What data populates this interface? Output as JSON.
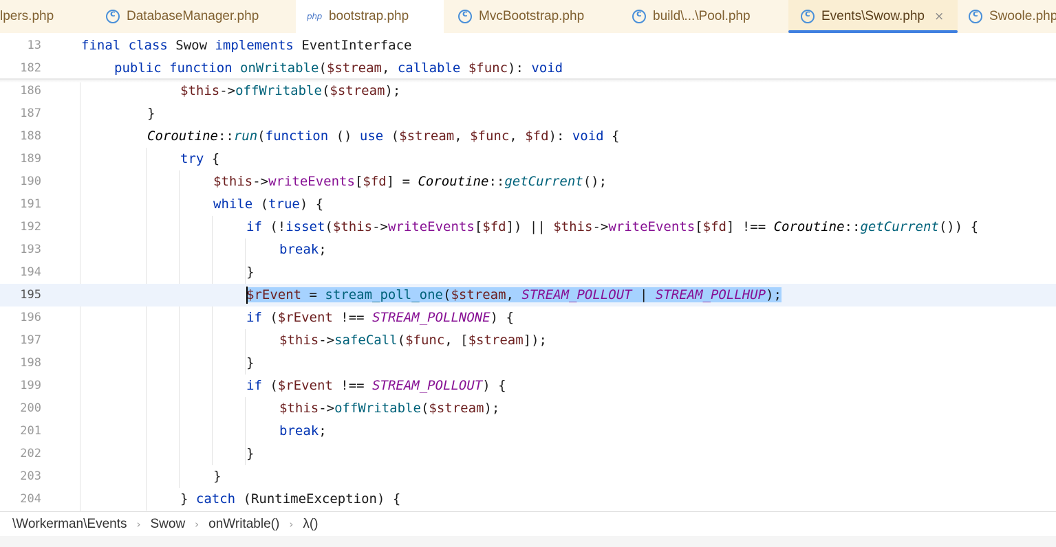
{
  "tabs": [
    {
      "label": "lpers.php",
      "icon": "none"
    },
    {
      "label": "DatabaseManager.php",
      "icon": "class-icon"
    },
    {
      "label": "bootstrap.php",
      "icon": "php-file-icon"
    },
    {
      "label": "MvcBootstrap.php",
      "icon": "class-icon"
    },
    {
      "label": "build\\...\\Pool.php",
      "icon": "class-icon"
    },
    {
      "label": "Events\\Swow.php",
      "icon": "class-icon",
      "active": true
    },
    {
      "label": "Swoole.php",
      "icon": "class-icon"
    }
  ],
  "php_badge": "php",
  "close_glyph": "×",
  "sticky": [
    {
      "num": "13",
      "code": "final class Swow implements EventInterface"
    },
    {
      "num": "182",
      "code": "public function onWritable($stream, callable $func): void"
    }
  ],
  "lines": [
    {
      "num": "186"
    },
    {
      "num": "187"
    },
    {
      "num": "188"
    },
    {
      "num": "189"
    },
    {
      "num": "190"
    },
    {
      "num": "191"
    },
    {
      "num": "192"
    },
    {
      "num": "193"
    },
    {
      "num": "194"
    },
    {
      "num": "195"
    },
    {
      "num": "196"
    },
    {
      "num": "197"
    },
    {
      "num": "198"
    },
    {
      "num": "199"
    },
    {
      "num": "200"
    },
    {
      "num": "201"
    },
    {
      "num": "202"
    },
    {
      "num": "203"
    },
    {
      "num": "204"
    }
  ],
  "current_line": "195",
  "breadcrumb": [
    "\\Workerman\\Events",
    "Swow",
    "onWritable()",
    "λ()"
  ],
  "breadcrumb_sep": "›",
  "colors": {
    "accent": "#3f7fe0",
    "selection": "#a6d2ff",
    "keyword": "#0033b3",
    "variable": "#6c1f1f",
    "function": "#00627a",
    "constant": "#871094"
  }
}
